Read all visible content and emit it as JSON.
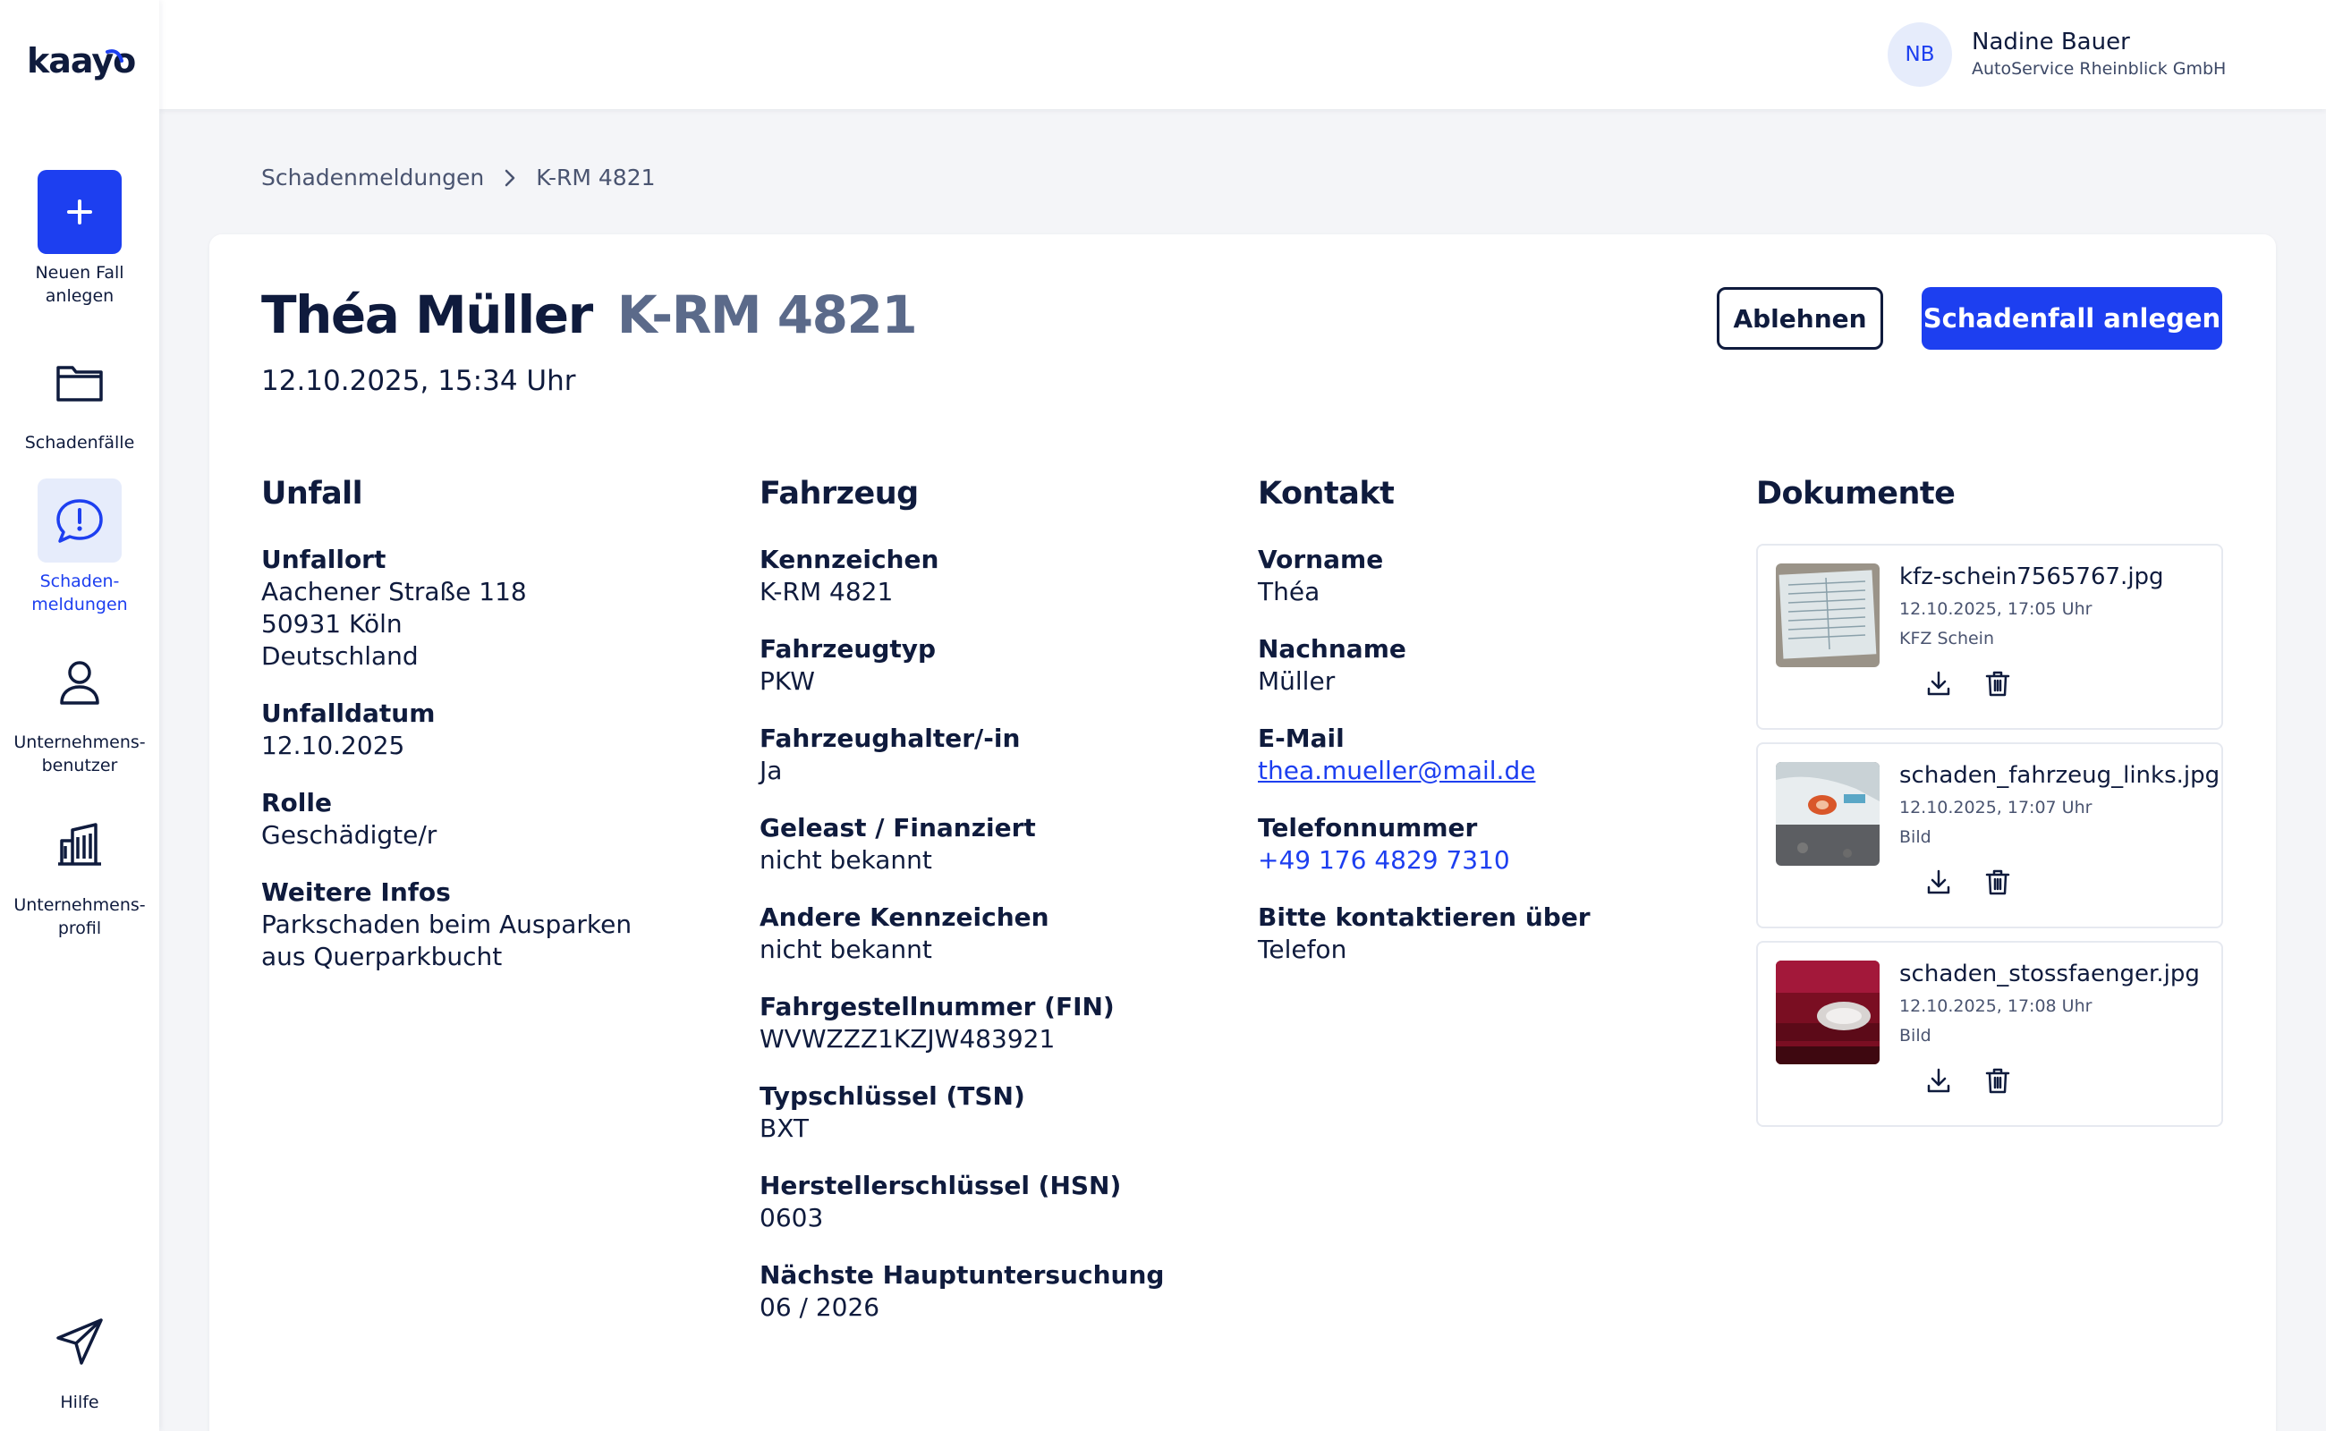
{
  "brand": {
    "logo_text": "kaayo"
  },
  "colors": {
    "accent": "#1d3ff0",
    "text": "#0f1b3d",
    "muted": "#5b6a8a",
    "background": "#f4f5f8"
  },
  "sidebar": {
    "items": [
      {
        "label": "Neuen Fall\nanlegen",
        "icon": "plus-icon"
      },
      {
        "label": "Schadenfälle",
        "icon": "folder-icon"
      },
      {
        "label": "Schaden-\nmeldungen",
        "icon": "alert-speech-bubble-icon",
        "active": true
      },
      {
        "label": "Unternehmens-\nbenutzer",
        "icon": "user-icon"
      },
      {
        "label": "Unternehmens-\nprofil",
        "icon": "building-icon"
      },
      {
        "label": "Hilfe",
        "icon": "paper-plane-icon"
      }
    ]
  },
  "user": {
    "initials": "NB",
    "name": "Nadine Bauer",
    "company": "AutoService Rheinblick GmbH"
  },
  "breadcrumb": {
    "parent": "Schadenmeldungen",
    "current": "K-RM 4821"
  },
  "header": {
    "name": "Théa Müller",
    "plate": "K-RM 4821",
    "datetime": "12.10.2025, 15:34 Uhr",
    "reject_label": "Ablehnen",
    "create_label": "Schadenfall anlegen"
  },
  "unfall": {
    "heading": "Unfall",
    "fields": [
      {
        "label": "Unfallort",
        "value": "Aachener Straße 118\n50931 Köln\nDeutschland"
      },
      {
        "label": "Unfalldatum",
        "value": "12.10.2025"
      },
      {
        "label": "Rolle",
        "value": "Geschädigte/r"
      },
      {
        "label": "Weitere Infos",
        "value": "Parkschaden beim Ausparken\naus Querparkbucht"
      }
    ]
  },
  "fahrzeug": {
    "heading": "Fahrzeug",
    "fields": [
      {
        "label": "Kennzeichen",
        "value": "K-RM 4821"
      },
      {
        "label": "Fahrzeugtyp",
        "value": "PKW"
      },
      {
        "label": "Fahrzeughalter/-in",
        "value": "Ja"
      },
      {
        "label": "Geleast / Finanziert",
        "value": "nicht bekannt"
      },
      {
        "label": "Andere Kennzeichen",
        "value": "nicht bekannt"
      },
      {
        "label": "Fahrgestellnummer (FIN)",
        "value": "WVWZZZ1KZJW483921"
      },
      {
        "label": "Typschlüssel (TSN)",
        "value": "BXT"
      },
      {
        "label": "Herstellerschlüssel (HSN)",
        "value": "0603"
      },
      {
        "label": "Nächste Hauptuntersuchung",
        "value": "06 / 2026"
      }
    ]
  },
  "kontakt": {
    "heading": "Kontakt",
    "fields": [
      {
        "label": "Vorname",
        "value": "Théa"
      },
      {
        "label": "Nachname",
        "value": "Müller"
      },
      {
        "label": "E-Mail",
        "value": "thea.mueller@mail.de"
      },
      {
        "label": "Telefonnummer",
        "value": "+49 176 4829 7310"
      },
      {
        "label": "Bitte kontaktieren über",
        "value": "Telefon"
      }
    ]
  },
  "dokumente": {
    "heading": "Dokumente",
    "items": [
      {
        "name": "kfz-schein7565767.jpg",
        "date": "12.10.2025, 17:05 Uhr",
        "type": "KFZ Schein"
      },
      {
        "name": "schaden_fahrzeug_links.jpg",
        "date": "12.10.2025, 17:07 Uhr",
        "type": "Bild"
      },
      {
        "name": "schaden_stossfaenger.jpg",
        "date": "12.10.2025, 17:08 Uhr",
        "type": "Bild"
      }
    ]
  }
}
